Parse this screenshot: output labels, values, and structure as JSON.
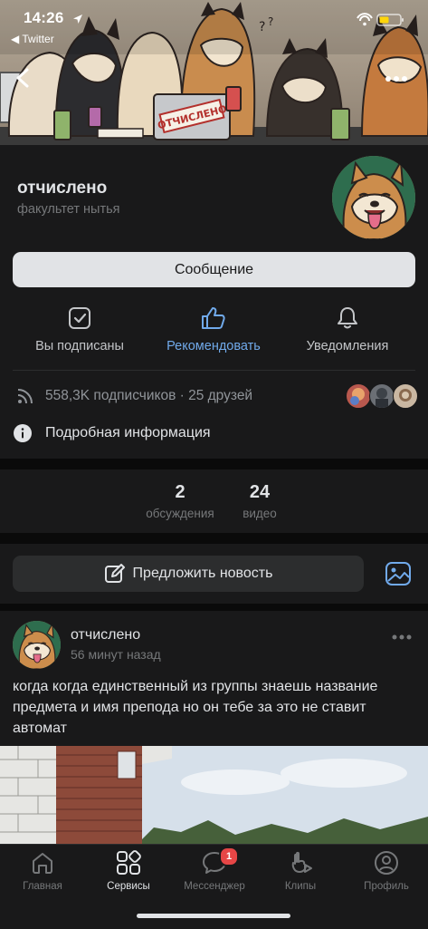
{
  "status_bar": {
    "time": "14:26",
    "back_app": "Twitter"
  },
  "cover": {
    "sign_text": "ОТЧИСЛЕНО"
  },
  "group": {
    "name": "отчислено",
    "status": "факультет нытья",
    "message_button": "Сообщение",
    "actions": [
      {
        "label": "Вы подписаны",
        "icon": "checkbox-icon"
      },
      {
        "label": "Рекомендовать",
        "icon": "thumbs-up-icon"
      },
      {
        "label": "Уведомления",
        "icon": "bell-icon"
      }
    ],
    "subscribers_text": "558,3K подписчиков · 25 друзей",
    "info_label": "Подробная информация"
  },
  "counters": [
    {
      "value": "2",
      "caption": "обсуждения"
    },
    {
      "value": "24",
      "caption": "видео"
    }
  ],
  "suggest": {
    "label": "Предложить новость"
  },
  "post": {
    "author": "отчислено",
    "time": "56 минут назад",
    "text": "когда когда единственный из группы знаешь название предмета и имя препода но он тебе за это не ставит автомат"
  },
  "tabbar": {
    "items": [
      {
        "label": "Главная",
        "icon": "home-icon",
        "active": false
      },
      {
        "label": "Сервисы",
        "icon": "services-icon",
        "active": true
      },
      {
        "label": "Мессенджер",
        "icon": "messenger-icon",
        "active": false,
        "badge": "1"
      },
      {
        "label": "Клипы",
        "icon": "clips-icon",
        "active": false
      },
      {
        "label": "Профиль",
        "icon": "profile-icon",
        "active": false
      }
    ]
  },
  "colors": {
    "background": "#0a0a0a",
    "card": "#19191a",
    "accent": "#71aaeb",
    "badge": "#e64646",
    "secondary_text": "#76787a"
  }
}
